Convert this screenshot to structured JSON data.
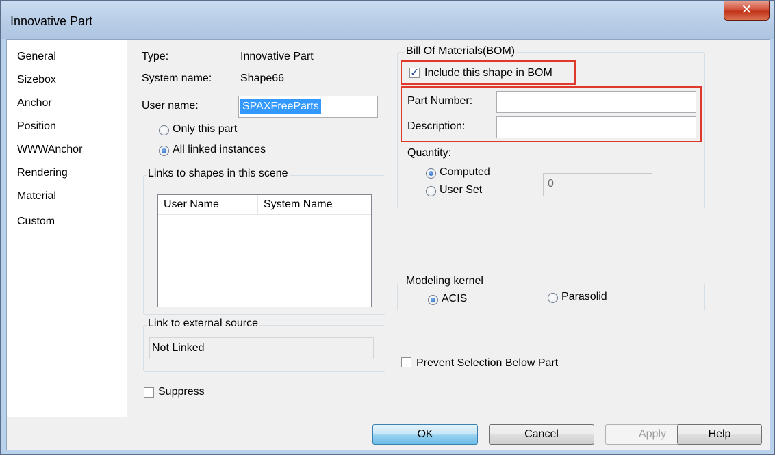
{
  "window": {
    "title": "Innovative Part",
    "close_icon": "close-icon"
  },
  "sidebar": {
    "items": [
      "General",
      "Sizebox",
      "Anchor",
      "Position",
      "WWWAnchor",
      "Rendering",
      "Material",
      "Custom"
    ]
  },
  "general": {
    "type_label": "Type:",
    "type_value": "Innovative Part",
    "system_name_label": "System name:",
    "system_name_value": "Shape66",
    "user_name_label": "User name:",
    "user_name_value": "SPAXFreeParts",
    "only_this_part": "Only this part",
    "all_linked": "All linked instances",
    "links_group": "Links to shapes in this scene",
    "col_user_name": "User Name",
    "col_system_name": "System Name",
    "external_group": "Link to external source",
    "external_value": "Not Linked",
    "suppress": "Suppress"
  },
  "bom": {
    "group": "Bill Of Materials(BOM)",
    "include": "Include this shape in BOM",
    "part_number_label": "Part Number:",
    "part_number_value": "",
    "description_label": "Description:",
    "description_value": "",
    "quantity_label": "Quantity:",
    "computed": "Computed",
    "user_set": "User Set",
    "quantity_value": "0"
  },
  "kernel": {
    "group": "Modeling kernel",
    "acis": "ACIS",
    "parasolid": "Parasolid"
  },
  "prevent": "Prevent Selection Below Part",
  "buttons": {
    "ok": "OK",
    "cancel": "Cancel",
    "apply": "Apply",
    "help": "Help"
  },
  "colors": {
    "highlight": "#e0392b",
    "selection": "#3399ff"
  }
}
